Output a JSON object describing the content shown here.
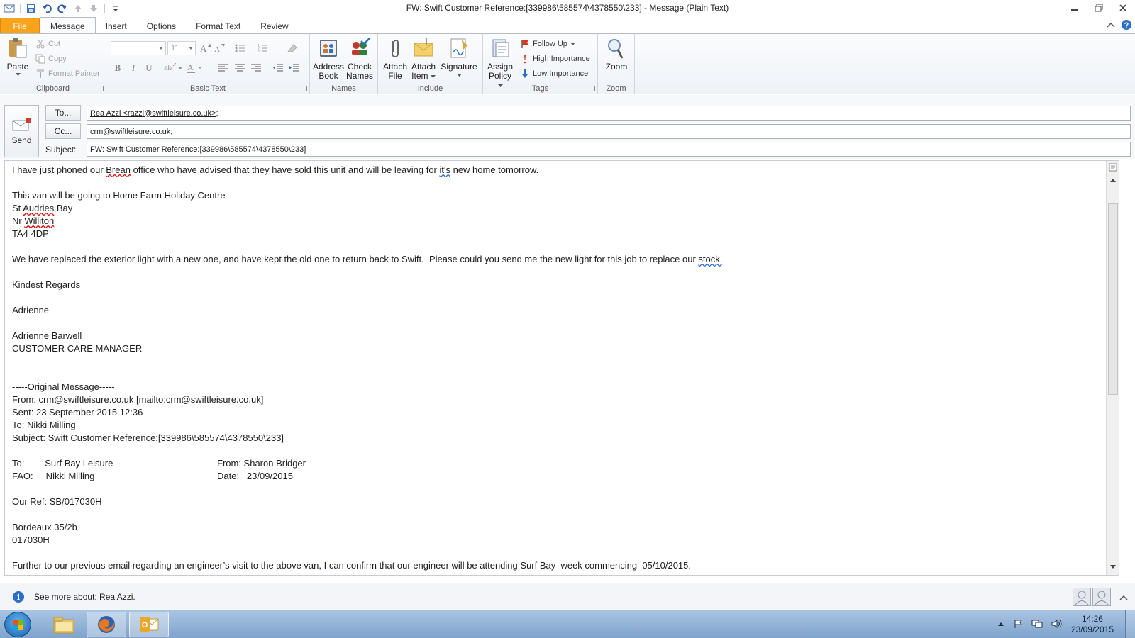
{
  "window": {
    "title": "FW: Swift Customer Reference:[339986\\585574\\4378550\\233]  -  Message (Plain Text)"
  },
  "tabs": [
    "File",
    "Message",
    "Insert",
    "Options",
    "Format Text",
    "Review"
  ],
  "ribbon": {
    "clipboard": {
      "label": "Clipboard",
      "paste": "Paste",
      "cut": "Cut",
      "copy": "Copy",
      "format_painter": "Format Painter"
    },
    "basic_text": {
      "label": "Basic Text",
      "font_size": "11"
    },
    "names": {
      "label": "Names",
      "address_book": [
        "Address",
        "Book"
      ],
      "check_names": [
        "Check",
        "Names"
      ]
    },
    "include": {
      "label": "Include",
      "attach_file": [
        "Attach",
        "File"
      ],
      "attach_item": [
        "Attach",
        "Item"
      ],
      "signature": "Signature"
    },
    "tags": {
      "label": "Tags",
      "assign_policy": [
        "Assign",
        "Policy"
      ],
      "follow_up": "Follow Up",
      "high_importance": "High Importance",
      "low_importance": "Low Importance"
    },
    "zoom": {
      "label": "Zoom",
      "zoom": "Zoom"
    }
  },
  "header": {
    "send": "Send",
    "to_button": "To...",
    "cc_button": "Cc...",
    "subject_label": "Subject:",
    "to_value": "Rea Azzi <razzi@swiftleisure.co.uk>",
    "cc_value": "crm@swiftleisure.co.uk",
    "subject_value": "FW: Swift Customer Reference:[339986\\585574\\4378550\\233]"
  },
  "body": {
    "l1a": "I have just phoned our ",
    "l1b": "Brean",
    "l1c": " office who have advised that they have sold this unit and will be leaving for ",
    "l1d": "it's",
    "l1e": " new home tomorrow.",
    "l2": "This van will be going to Home Farm Holiday Centre",
    "l3a": "St ",
    "l3b": "Audries",
    "l3c": " Bay",
    "l4a": "Nr ",
    "l4b": "Williton",
    "l5": "TA4 4DP",
    "l6a": "We have replaced the exterior light with a new one, and have kept the old one to return back to Swift.  Please could you send me the new light for this job to replace our ",
    "l6b": "stock.",
    "l7": "Kindest Regards",
    "l8": "Adrienne",
    "l9": "Adrienne Barwell",
    "l10": "CUSTOMER CARE MANAGER",
    "l11": "-----Original Message-----",
    "l12": "From: crm@swiftleisure.co.uk [mailto:crm@swiftleisure.co.uk]",
    "l13": "Sent: 23 September 2015 12:36",
    "l14": "To: Nikki Milling",
    "l15": "Subject: Swift Customer Reference:[339986\\585574\\4378550\\233]",
    "l16a": "To:        Surf Bay Leisure",
    "l16b": "From: Sharon Bridger",
    "l17a": "FAO:     Nikki Milling",
    "l17b": "Date:   23/09/2015",
    "l18": "Our Ref: SB/017030H",
    "l19": "Bordeaux 35/2b",
    "l20": "017030H",
    "l21": "Further to our previous email regarding an engineer’s visit to the above van, I can confirm that our engineer will be attending Surf Bay  week commencing  05/10/2015."
  },
  "people_pane": {
    "text": "See more about: Rea Azzi."
  },
  "taskbar": {
    "time": "14:26",
    "date": "23/09/2015"
  }
}
